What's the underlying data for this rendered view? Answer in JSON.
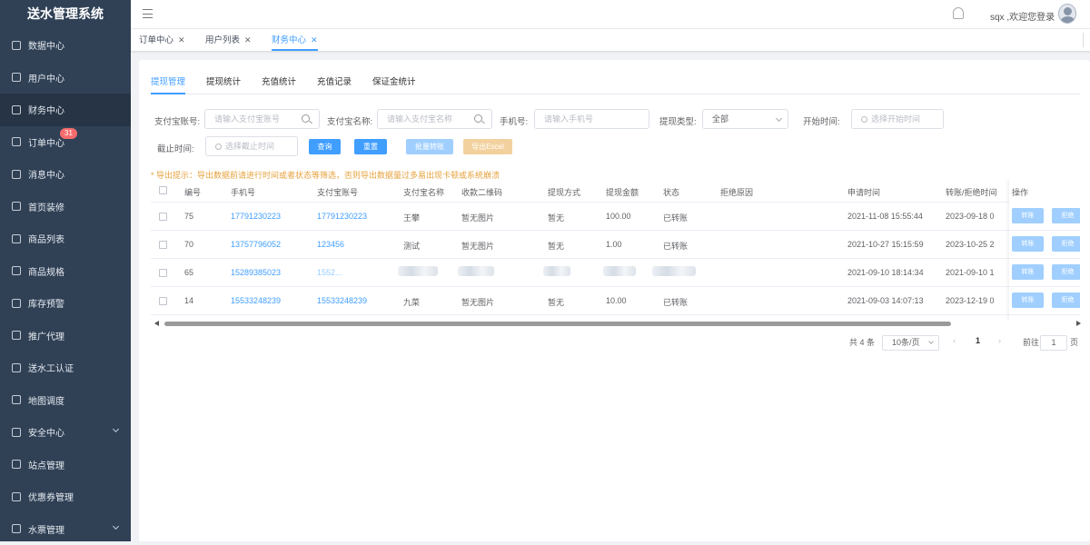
{
  "app": {
    "title": "送水管理系统"
  },
  "sidebar": {
    "items": [
      {
        "label": "数据中心"
      },
      {
        "label": "用户中心"
      },
      {
        "label": "财务中心"
      },
      {
        "label": "订单中心",
        "badge": "31"
      },
      {
        "label": "消息中心"
      },
      {
        "label": "首页装修"
      },
      {
        "label": "商品列表"
      },
      {
        "label": "商品规格"
      },
      {
        "label": "库存预警"
      },
      {
        "label": "推广代理"
      },
      {
        "label": "送水工认证"
      },
      {
        "label": "地图调度"
      },
      {
        "label": "安全中心"
      },
      {
        "label": "站点管理"
      },
      {
        "label": "优惠券管理"
      },
      {
        "label": "水票管理"
      }
    ]
  },
  "header": {
    "welcome": "sqx ,欢迎您登录"
  },
  "tags": [
    {
      "label": "订单中心"
    },
    {
      "label": "用户列表"
    },
    {
      "label": "财务中心"
    }
  ],
  "tabs": [
    {
      "label": "提现管理"
    },
    {
      "label": "提现统计"
    },
    {
      "label": "充值统计"
    },
    {
      "label": "充值记录"
    },
    {
      "label": "保证金统计"
    }
  ],
  "filters": {
    "alipay_account": {
      "label": "支付宝账号:",
      "placeholder": "请输入支付宝账号"
    },
    "alipay_name": {
      "label": "支付宝名称:",
      "placeholder": "请输入支付宝名称"
    },
    "phone": {
      "label": "手机号:",
      "placeholder": "请输入手机号"
    },
    "withdraw_type": {
      "label": "提现类型:",
      "value": "全部"
    },
    "start_time": {
      "label": "开始时间:",
      "placeholder": "选择开始时间"
    },
    "end_time": {
      "label": "截止时间:",
      "placeholder": "选择截止时间"
    }
  },
  "buttons": {
    "query": "查询",
    "reset": "重置",
    "batch": "批量转账",
    "export": "导出Excel"
  },
  "tip": "* 导出提示：导出数据前请进行时间或者状态等筛选，否则导出数据量过多易出现卡顿或系统崩溃",
  "table": {
    "headers": [
      "编号",
      "手机号",
      "支付宝账号",
      "支付宝名称",
      "收款二维码",
      "提现方式",
      "提现金额",
      "状态",
      "拒绝原因",
      "申请时间",
      "转账/拒绝时间",
      "操作"
    ],
    "rows": [
      {
        "id": "75",
        "phone": "17791230223",
        "alipay": "17791230223",
        "name": "王攀",
        "qrcode": "暂无图片",
        "method": "暂无",
        "amount": "100.00",
        "status": "已转账",
        "reason": "",
        "apply_time": "2021-11-08 15:55:44",
        "done_time": "2023-09-18 0"
      },
      {
        "id": "70",
        "phone": "13757796052",
        "alipay": "123456",
        "name": "测试",
        "qrcode": "暂无图片",
        "method": "暂无",
        "amount": "1.00",
        "status": "已转账",
        "reason": "",
        "apply_time": "2021-10-27 15:15:59",
        "done_time": "2023-10-25 2"
      },
      {
        "id": "65",
        "phone": "15289385023",
        "alipay": "1552...",
        "name": "",
        "qrcode": "",
        "method": "",
        "amount": "",
        "status": "",
        "reason": "",
        "apply_time": "2021-09-10 18:14:34",
        "done_time": "2021-09-10 1"
      },
      {
        "id": "14",
        "phone": "15533248239",
        "alipay": "15533248239",
        "name": "九菜",
        "qrcode": "暂无图片",
        "method": "暂无",
        "amount": "10.00",
        "status": "已转账",
        "reason": "",
        "apply_time": "2021-09-03 14:07:13",
        "done_time": "2023-12-19 0"
      }
    ],
    "op_transfer": "转账",
    "op_reject": "拒绝"
  },
  "pagination": {
    "total": "共 4 条",
    "page_size": "10条/页",
    "current": "1",
    "goto_label": "前往",
    "goto_value": "1",
    "page_suffix": "页"
  },
  "colors": {
    "sidebar_bg": "#304156",
    "primary": "#409eff",
    "primary_light": "#a0cfff",
    "warning": "#e6a23c",
    "danger_badge": "#f56c6c"
  }
}
